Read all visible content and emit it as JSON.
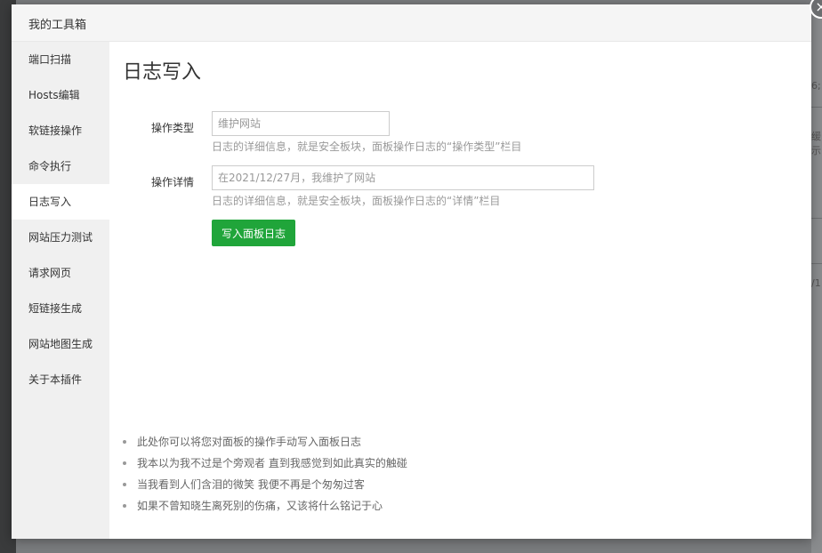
{
  "dialog": {
    "title": "我的工具箱",
    "close_symbol": "×"
  },
  "sidebar": {
    "items": [
      {
        "label": "端口扫描"
      },
      {
        "label": "Hosts编辑"
      },
      {
        "label": "软链接操作"
      },
      {
        "label": "命令执行"
      },
      {
        "label": "日志写入",
        "active": true
      },
      {
        "label": "网站压力测试"
      },
      {
        "label": "请求网页"
      },
      {
        "label": "短链接生成"
      },
      {
        "label": "网站地图生成"
      },
      {
        "label": "关于本插件"
      }
    ]
  },
  "main": {
    "title": "日志写入",
    "form": {
      "type": {
        "label": "操作类型",
        "value": "",
        "placeholder": "维护网站",
        "help": "日志的详细信息，就是安全板块，面板操作日志的“操作类型”栏目"
      },
      "detail": {
        "label": "操作详情",
        "value": "",
        "placeholder": "在2021/12/27月，我维护了网站",
        "help": "日志的详细信息，就是安全板块，面板操作日志的“详情”栏目"
      },
      "submit_label": "写入面板日志"
    },
    "tips": [
      "此处你可以将您对面板的操作手动写入面板日志",
      "我本以为我不过是个旁观者 直到我感觉到如此真实的触碰",
      "当我看到人们含泪的微笑 我便不再是个匆匆过客",
      "如果不曾知晓生离死别的伤痛，又该将什么铭记于心"
    ]
  },
  "background": {
    "edge_text_1": "6;",
    "edge_text_2": "缓示",
    "edge_text_3": "/1"
  },
  "colors": {
    "accent": "#20a53a",
    "sidebar_bg": "#f0f0f0",
    "header_bg": "#f5f5f5",
    "overlay": "#7a7c7e"
  },
  "icons": {
    "close": "close-icon",
    "bullet": "bullet-dot"
  }
}
